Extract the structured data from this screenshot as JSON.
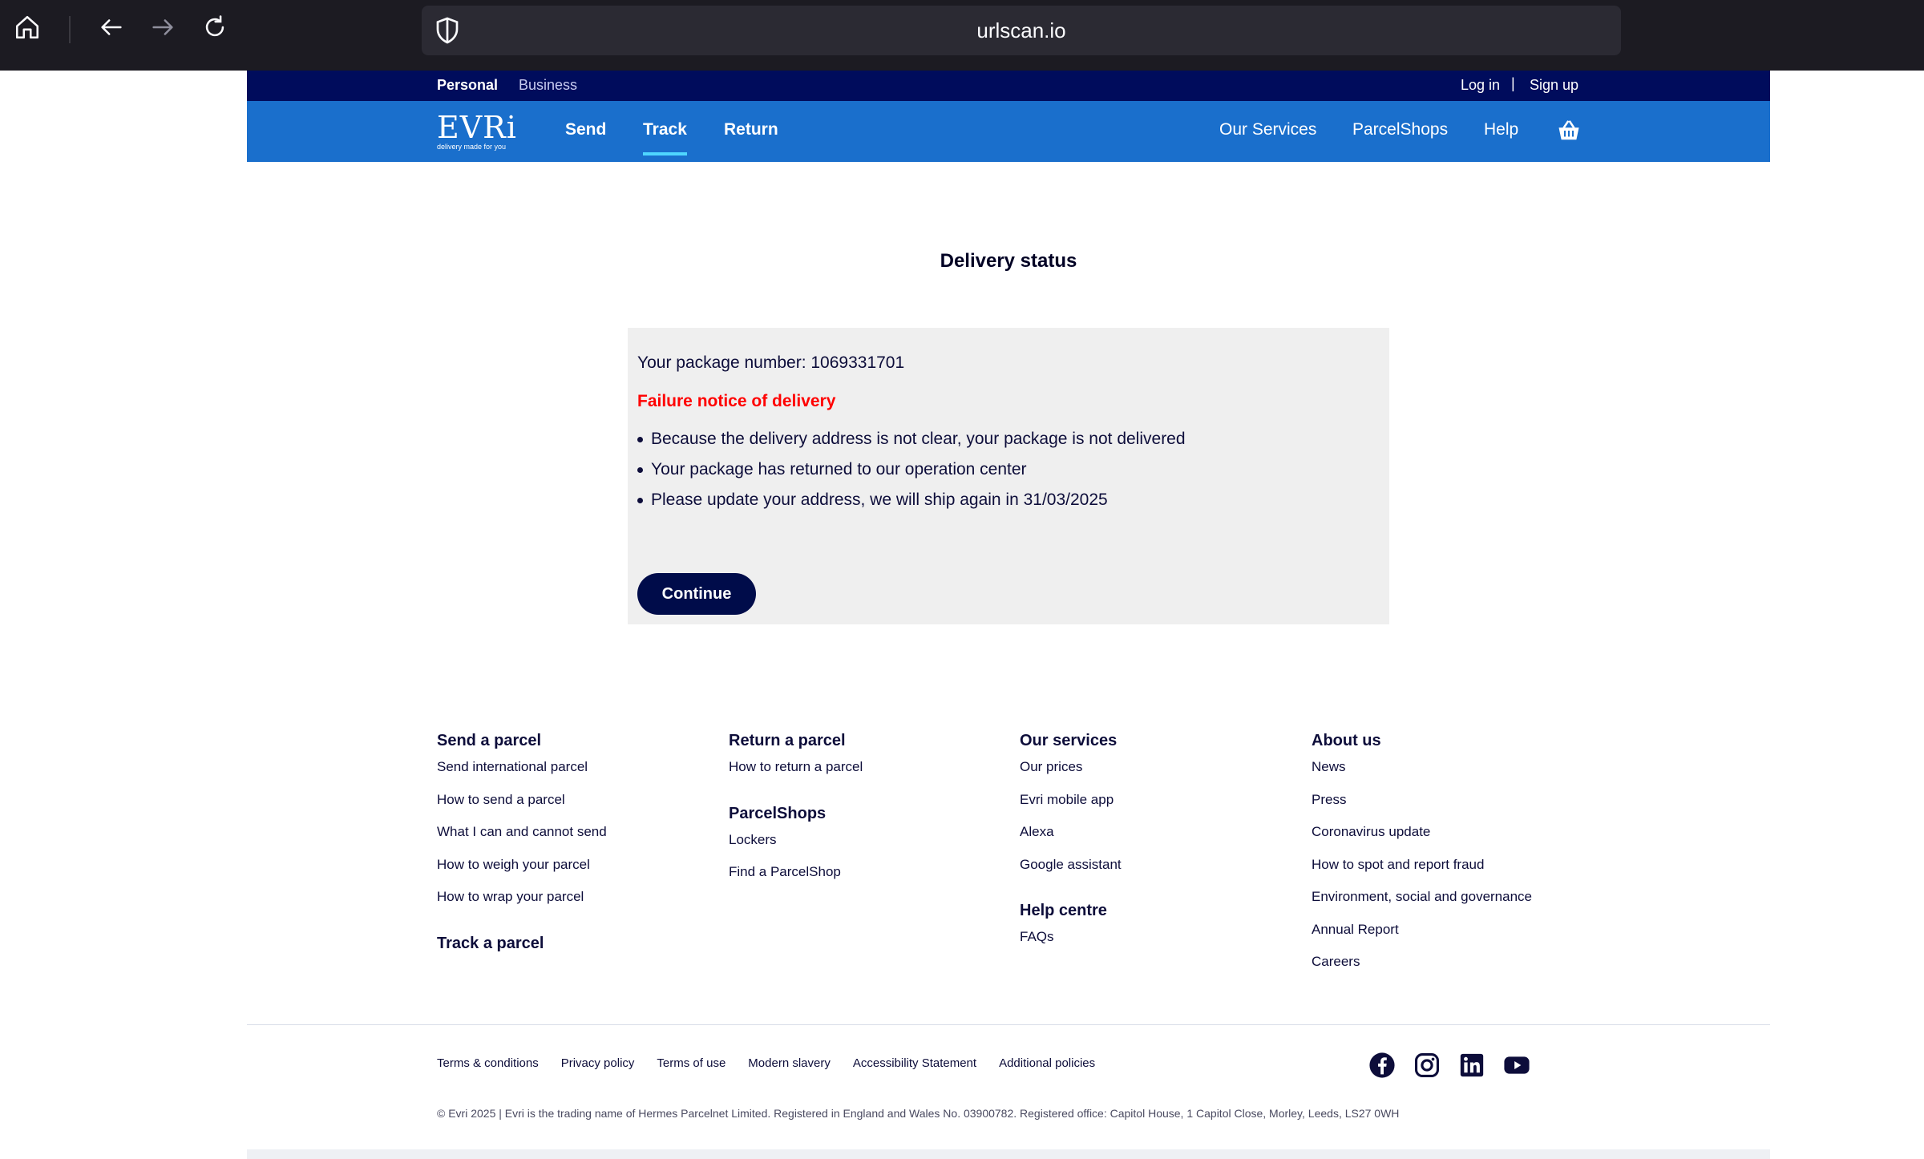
{
  "browser": {
    "url": "urlscan.io"
  },
  "topstrip": {
    "personal": "Personal",
    "business": "Business",
    "login": "Log in",
    "separator": "|",
    "signup": "Sign up"
  },
  "nav": {
    "logo_word": "EVRi",
    "logo_tagline": "delivery made for you",
    "send": "Send",
    "track": "Track",
    "return": "Return",
    "our_services": "Our Services",
    "parcelshops": "ParcelShops",
    "help": "Help"
  },
  "main": {
    "heading": "Delivery status",
    "package_number": "Your package number: 1069331701",
    "failure_notice": "Failure notice of delivery",
    "bullets": [
      "Because the delivery address is not clear, your package is not delivered",
      "Your package has returned to our operation center",
      "Please update your address, we will ship again in 31/03/2025"
    ],
    "continue_label": "Continue"
  },
  "footer": {
    "col1": {
      "title": "Send a parcel",
      "links": [
        "Send international parcel",
        "How to send a parcel",
        "What I can and cannot send",
        "How to weigh your parcel",
        "How to wrap your parcel"
      ],
      "title2": "Track a parcel"
    },
    "col2": {
      "title": "Return a parcel",
      "links": [
        "How to return a parcel"
      ],
      "title2": "ParcelShops",
      "links2": [
        "Lockers",
        "Find a ParcelShop"
      ]
    },
    "col3": {
      "title": "Our services",
      "links": [
        "Our prices",
        "Evri mobile app",
        "Alexa",
        "Google assistant"
      ],
      "title2": "Help centre",
      "links2": [
        "FAQs"
      ]
    },
    "col4": {
      "title": "About us",
      "links": [
        "News",
        "Press",
        "Coronavirus update",
        "How to spot and report fraud",
        "Environment, social and governance",
        "Annual Report",
        "Careers"
      ]
    },
    "legal": [
      "Terms & conditions",
      "Privacy policy",
      "Terms of use",
      "Modern slavery",
      "Accessibility Statement",
      "Additional policies"
    ],
    "copyright": "© Evri 2025 | Evri is the trading name of Hermes Parcelnet Limited. Registered in England and Wales No. 03900782. Registered office: Capitol House, 1 Capitol Close, Morley, Leeds, LS27 0WH"
  },
  "colors": {
    "top_strip": "#000c5c",
    "nav_blue": "#1a6fcc",
    "active_underline": "#4fd6ff",
    "failure_red": "#ff0000",
    "button_navy": "#000c4a"
  },
  "icons": [
    "home-icon",
    "back-icon",
    "forward-icon",
    "reload-icon",
    "shield-icon",
    "basket-icon",
    "facebook-icon",
    "instagram-icon",
    "linkedin-icon",
    "youtube-icon"
  ]
}
